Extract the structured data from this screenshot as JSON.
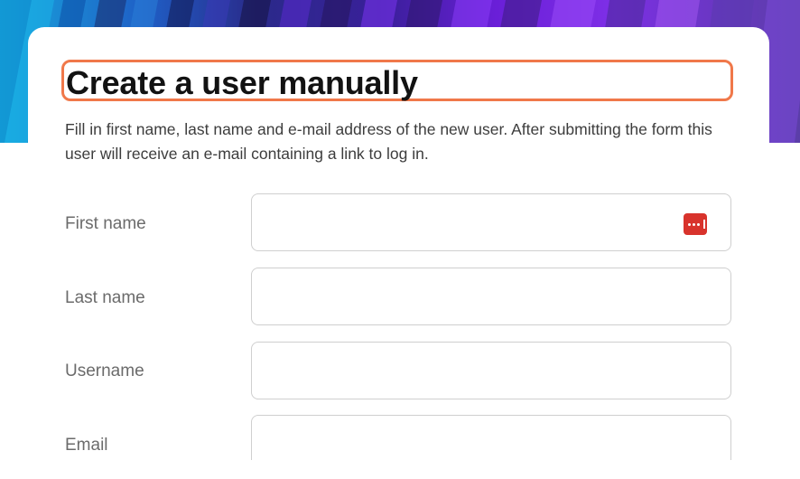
{
  "page": {
    "title": "Create a user manually",
    "description": "Fill in first name, last name and e-mail address of the new user. After submitting the form this user will receive an e-mail containing a link to log in."
  },
  "form": {
    "fields": [
      {
        "label": "First name",
        "value": ""
      },
      {
        "label": "Last name",
        "value": ""
      },
      {
        "label": "Username",
        "value": ""
      },
      {
        "label": "Email",
        "value": ""
      }
    ]
  },
  "icons": {
    "password_manager": "password-manager-icon"
  },
  "colors": {
    "highlight": "#f0784a",
    "password_manager": "#d8332c"
  }
}
